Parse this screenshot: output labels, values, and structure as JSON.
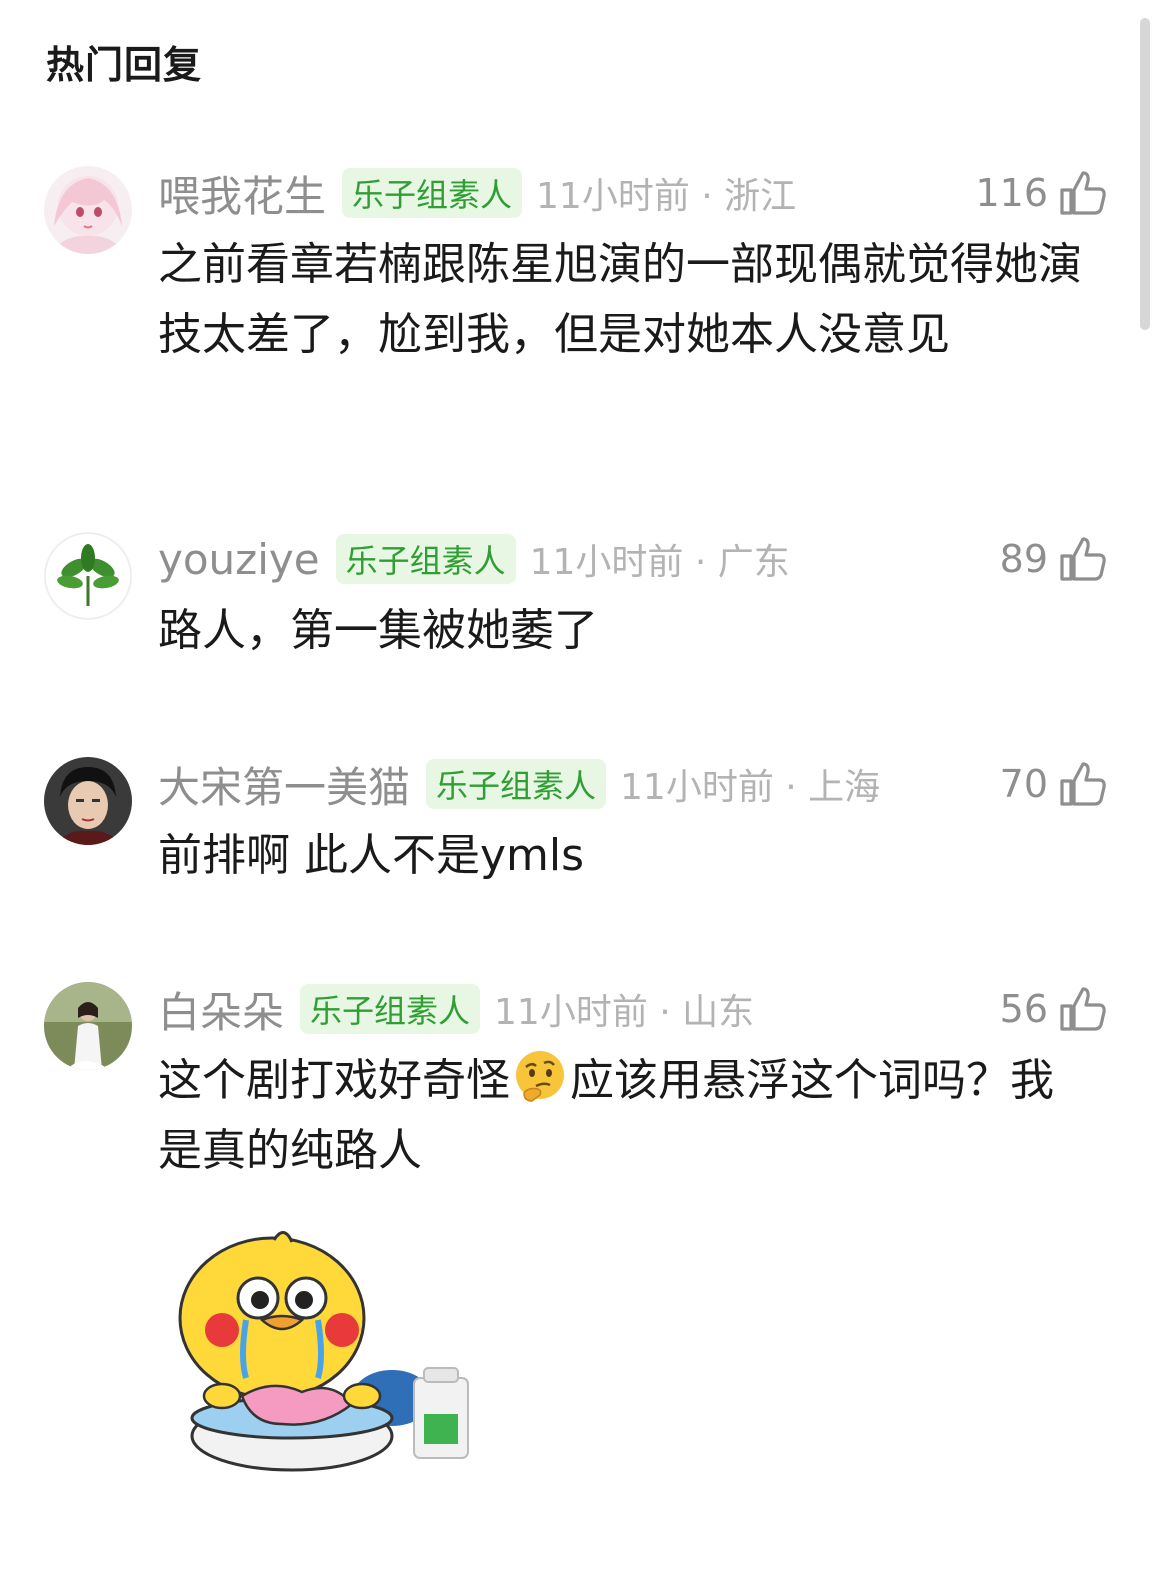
{
  "section_title": "热门回复",
  "comments": [
    {
      "username": "喂我花生",
      "badge": "乐子组素人",
      "time_location": "11小时前 · 浙江",
      "likes": "116",
      "content": "之前看章若楠跟陈星旭演的一部现偶就觉得她演技太差了，尬到我，但是对她本人没意见",
      "avatar_icon": "anime-girl-avatar"
    },
    {
      "username": "youziye",
      "badge": "乐子组素人",
      "time_location": "11小时前 · 广东",
      "likes": "89",
      "content": "路人，第一集被她萎了",
      "avatar_icon": "green-plant-avatar"
    },
    {
      "username": "大宋第一美猫",
      "badge": "乐子组素人",
      "time_location": "11小时前 · 上海",
      "likes": "70",
      "content": "前排啊 此人不是ymls",
      "avatar_icon": "portrait-avatar"
    },
    {
      "username": "白朵朵",
      "badge": "乐子组素人",
      "time_location": "11小时前 · 山东",
      "likes": "56",
      "content_before_emoji": "这个剧打戏好奇怪",
      "content_after_emoji": "应该用悬浮这个词吗？我是真的纯路人",
      "emoji": "thinking-face",
      "avatar_icon": "woman-photo-avatar"
    }
  ],
  "sticker": "crying-duck-washing-clothes-sticker",
  "colors": {
    "badge_text": "#2f9e33",
    "badge_bg": "#e8f6e4",
    "meta_gray": "#8e8e8e",
    "time_gray": "#b3b3b3"
  }
}
